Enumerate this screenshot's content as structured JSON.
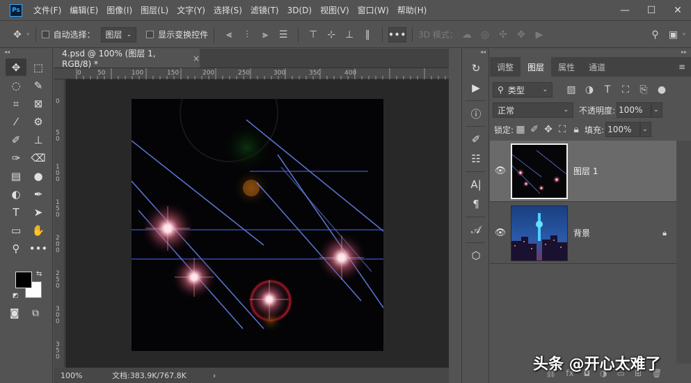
{
  "app": {
    "logo": "Ps"
  },
  "menu": [
    "文件(F)",
    "编辑(E)",
    "图像(I)",
    "图层(L)",
    "文字(Y)",
    "选择(S)",
    "滤镜(T)",
    "3D(D)",
    "视图(V)",
    "窗口(W)",
    "帮助(H)"
  ],
  "window_controls": {
    "minimize": "—",
    "maximize": "☐",
    "close": "✕"
  },
  "options_bar": {
    "auto_select_label": "自动选择：",
    "auto_select_target": "图层",
    "show_transform_label": "显示变换控件",
    "mode_3d_label": "3D 模式：",
    "more": "•••"
  },
  "document": {
    "tab_title": "4.psd @ 100% (图层 1, RGB/8) *",
    "tab_close": "×",
    "ruler_h_ticks": [
      "0",
      "50",
      "100",
      "150",
      "200",
      "250",
      "300",
      "350",
      "400"
    ],
    "ruler_v_ticks": [
      "0",
      "5\n0",
      "1\n0\n0",
      "1\n5\n0",
      "2\n0\n0",
      "2\n5\n0",
      "3\n0\n0",
      "3\n5\n0"
    ],
    "zoom": "100%",
    "doc_size": "文档:383.9K/767.8K",
    "status_arrow": "›"
  },
  "layers_panel": {
    "tabs": [
      "调整",
      "图层",
      "属性",
      "通道"
    ],
    "active_tab": "图层",
    "filter_kind": "类型",
    "blend_mode": "正常",
    "opacity_label": "不透明度:",
    "opacity_value": "100%",
    "lock_label": "锁定:",
    "fill_label": "填充:",
    "fill_value": "100%",
    "layers": [
      {
        "name": "图层 1",
        "visible": true,
        "selected": true,
        "locked": false
      },
      {
        "name": "背景",
        "visible": true,
        "selected": false,
        "locked": true
      }
    ]
  },
  "watermark": "头条 @开心太难了"
}
